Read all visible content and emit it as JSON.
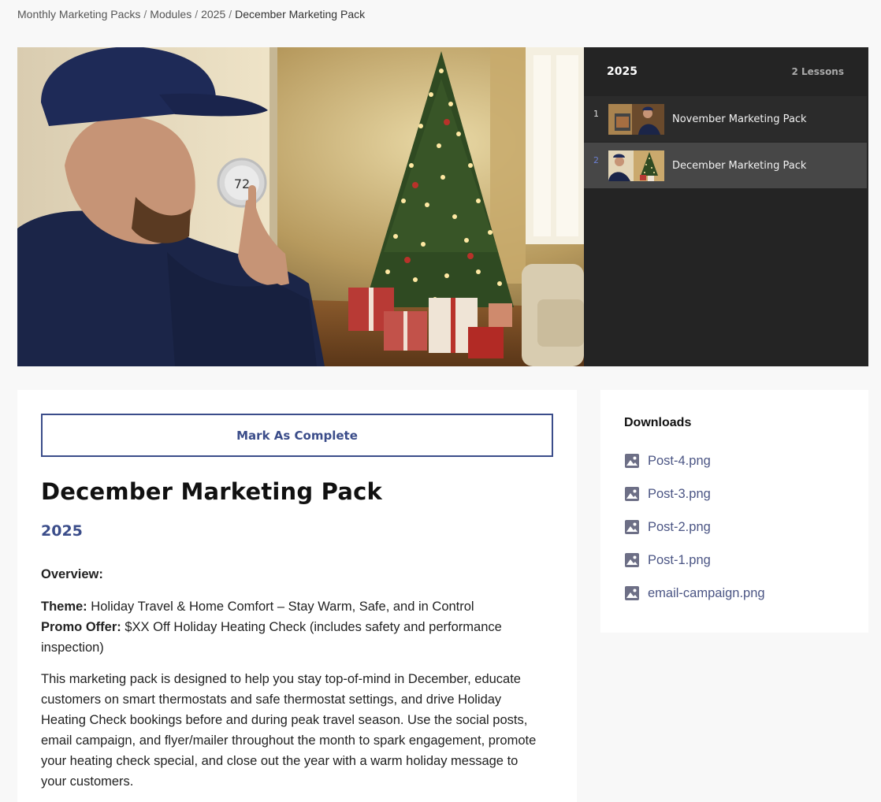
{
  "breadcrumb": {
    "items": [
      "Monthly Marketing Packs",
      "Modules",
      "2025"
    ],
    "current": "December Marketing Pack"
  },
  "playlist": {
    "title": "2025",
    "count": "2 Lessons",
    "lessons": [
      {
        "number": "1",
        "title": "November Marketing Pack"
      },
      {
        "number": "2",
        "title": "December Marketing Pack"
      }
    ]
  },
  "main": {
    "mark_complete_label": "Mark As Complete",
    "heading": "December Marketing Pack",
    "subheading": "2025",
    "overview_label": "Overview:",
    "theme_label": "Theme:",
    "theme_text": " Holiday Travel & Home Comfort – Stay Warm, Safe, and in Control",
    "promo_label": "Promo Offer:",
    "promo_text": " $XX Off Holiday Heating Check (includes safety and performance inspection)",
    "description": "This marketing pack is designed to help you stay top-of-mind in December, educate customers on smart thermostats and safe thermostat settings, and drive Holiday Heating Check bookings before and during peak travel season. Use the social posts, email campaign, and flyer/mailer throughout the month to spark engagement, promote your heating check special, and close out the year with a warm holiday message to your customers."
  },
  "hero": {
    "thermostat_reading": "72"
  },
  "downloads": {
    "title": "Downloads",
    "files": [
      "Post-4.png",
      "Post-3.png",
      "Post-2.png",
      "Post-1.png",
      "email-campaign.png"
    ]
  },
  "colors": {
    "accent": "#3b4d8a",
    "link": "#4b5584",
    "panel_dark": "#242424",
    "active_row": "#474747"
  }
}
